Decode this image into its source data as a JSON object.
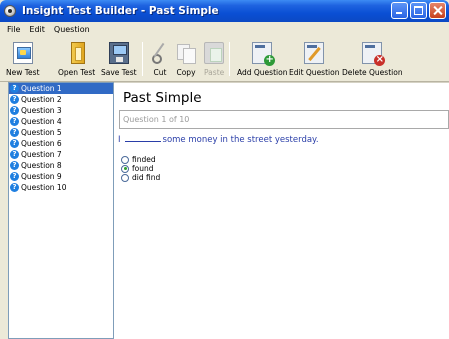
{
  "window": {
    "title": "Insight Test Builder - Past Simple"
  },
  "menu": [
    "File",
    "Edit",
    "Question"
  ],
  "toolbar": {
    "new_test": "New Test",
    "open_test": "Open Test",
    "save_test": "Save Test",
    "cut": "Cut",
    "copy": "Copy",
    "paste": "Paste",
    "add_question": "Add Question",
    "edit_question": "Edit Question",
    "delete_question": "Delete Question"
  },
  "questions": [
    {
      "label": "Question 1",
      "selected": true
    },
    {
      "label": "Question 2"
    },
    {
      "label": "Question 3"
    },
    {
      "label": "Question 4"
    },
    {
      "label": "Question 5"
    },
    {
      "label": "Question 6"
    },
    {
      "label": "Question 7"
    },
    {
      "label": "Question 8"
    },
    {
      "label": "Question 9"
    },
    {
      "label": "Question 10"
    }
  ],
  "main": {
    "title": "Past Simple",
    "progress": "Question 1 of 10",
    "prompt_start": "I",
    "prompt_end": "some money in the street yesterday.",
    "options": [
      {
        "label": "finded",
        "selected": false
      },
      {
        "label": "found",
        "selected": true
      },
      {
        "label": "did find",
        "selected": false
      }
    ]
  },
  "colors": {
    "titlebar": "#0a4fd4",
    "selection": "#316ac5",
    "prompt": "#2a3ea8"
  }
}
